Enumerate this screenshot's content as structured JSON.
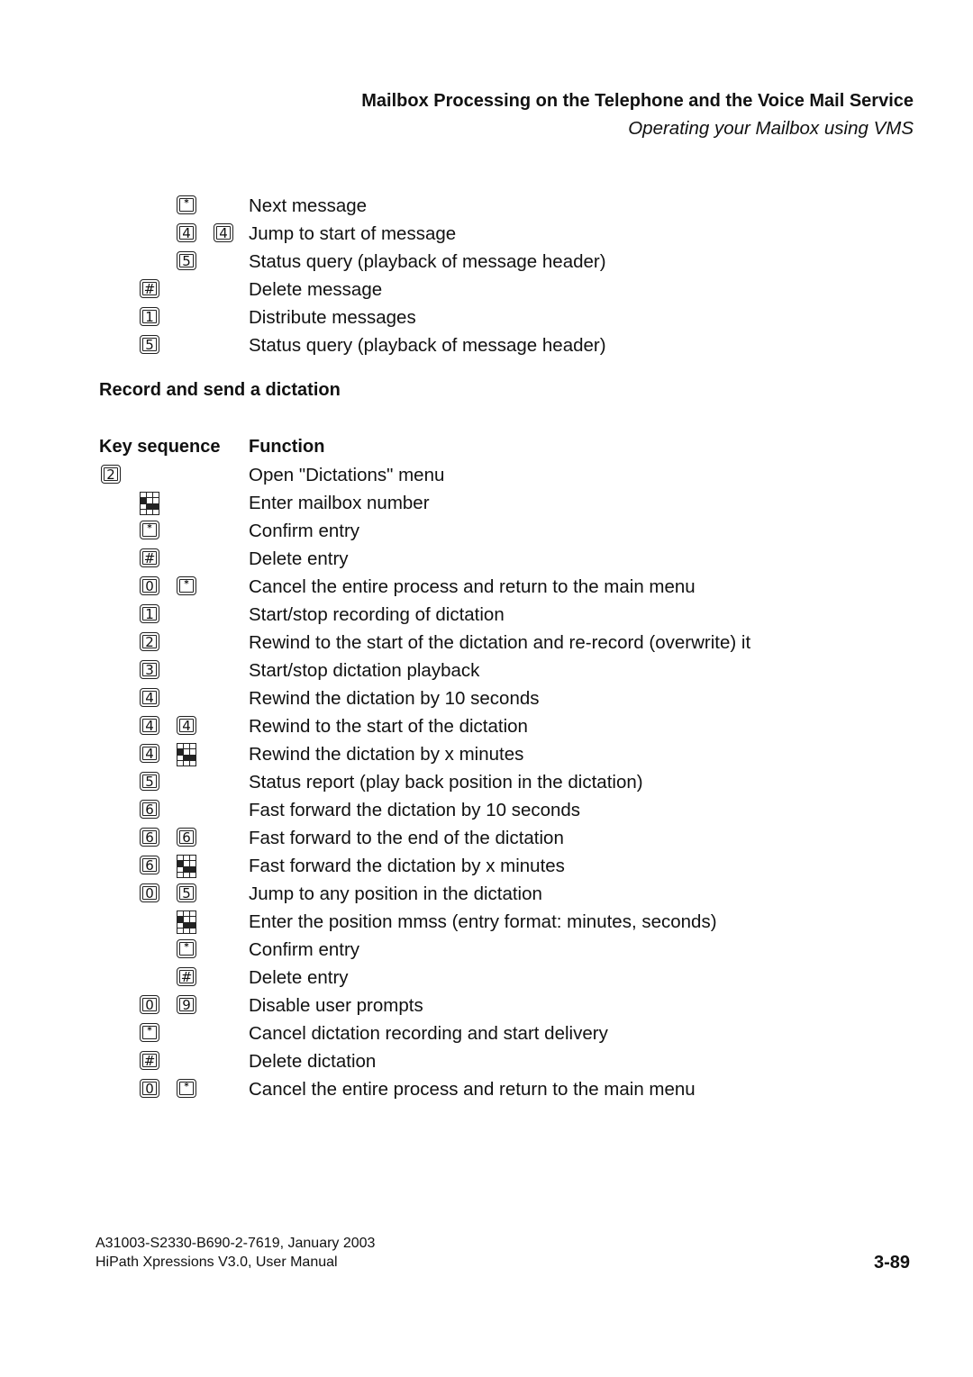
{
  "header": {
    "title": "Mailbox Processing on the Telephone and the Voice Mail Service",
    "subtitle": "Operating your Mailbox using VMS"
  },
  "top_rows": [
    {
      "keys": [
        {
          "level": 2,
          "key": "*"
        }
      ],
      "text": "Next message"
    },
    {
      "keys": [
        {
          "level": 2,
          "key": "4"
        },
        {
          "level": 3,
          "key": "4"
        }
      ],
      "text": "Jump to start of message"
    },
    {
      "keys": [
        {
          "level": 2,
          "key": "5"
        }
      ],
      "text": "Status query (playback of message header)"
    },
    {
      "keys": [
        {
          "level": 1,
          "key": "#"
        }
      ],
      "text": "Delete message"
    },
    {
      "keys": [
        {
          "level": 1,
          "key": "1"
        }
      ],
      "text": "Distribute messages"
    },
    {
      "keys": [
        {
          "level": 1,
          "key": "5"
        }
      ],
      "text": "Status query (playback of message header)"
    }
  ],
  "section": {
    "title": "Record and send a dictation",
    "col_key": "Key sequence",
    "col_function": "Function"
  },
  "rows": [
    {
      "keys": [
        {
          "level": 0,
          "key": "2"
        }
      ],
      "text": "Open \"Dictations\" menu"
    },
    {
      "keys": [
        {
          "level": 1,
          "key": "keypad"
        }
      ],
      "text": "Enter mailbox number"
    },
    {
      "keys": [
        {
          "level": 1,
          "key": "*"
        }
      ],
      "text": "Confirm entry"
    },
    {
      "keys": [
        {
          "level": 1,
          "key": "#"
        }
      ],
      "text": "Delete entry"
    },
    {
      "keys": [
        {
          "level": 1,
          "key": "0"
        },
        {
          "level": 2,
          "key": "*"
        }
      ],
      "text": "Cancel the entire process and return to the main menu"
    },
    {
      "keys": [
        {
          "level": 1,
          "key": "1"
        }
      ],
      "text": "Start/stop recording of dictation"
    },
    {
      "keys": [
        {
          "level": 1,
          "key": "2"
        }
      ],
      "text": "Rewind to the start of the dictation and re-record (overwrite) it"
    },
    {
      "keys": [
        {
          "level": 1,
          "key": "3"
        }
      ],
      "text": "Start/stop dictation playback"
    },
    {
      "keys": [
        {
          "level": 1,
          "key": "4"
        }
      ],
      "text": "Rewind the dictation by 10 seconds"
    },
    {
      "keys": [
        {
          "level": 1,
          "key": "4"
        },
        {
          "level": 2,
          "key": "4"
        }
      ],
      "text": "Rewind to the start of the dictation"
    },
    {
      "keys": [
        {
          "level": 1,
          "key": "4"
        },
        {
          "level": 2,
          "key": "keypad"
        }
      ],
      "text": "Rewind the dictation by x minutes"
    },
    {
      "keys": [
        {
          "level": 1,
          "key": "5"
        }
      ],
      "text": "Status report (play back position in the dictation)"
    },
    {
      "keys": [
        {
          "level": 1,
          "key": "6"
        }
      ],
      "text": "Fast forward the dictation by 10 seconds"
    },
    {
      "keys": [
        {
          "level": 1,
          "key": "6"
        },
        {
          "level": 2,
          "key": "6"
        }
      ],
      "text": "Fast forward to the end of the dictation"
    },
    {
      "keys": [
        {
          "level": 1,
          "key": "6"
        },
        {
          "level": 2,
          "key": "keypad"
        }
      ],
      "text": "Fast forward the dictation by x minutes"
    },
    {
      "keys": [
        {
          "level": 1,
          "key": "0"
        },
        {
          "level": 2,
          "key": "5"
        }
      ],
      "text": "Jump to any position in the dictation"
    },
    {
      "keys": [
        {
          "level": 2,
          "key": "keypad"
        }
      ],
      "text": "Enter the position mmss (entry format: minutes, seconds)"
    },
    {
      "keys": [
        {
          "level": 2,
          "key": "*"
        }
      ],
      "text": "Confirm entry"
    },
    {
      "keys": [
        {
          "level": 2,
          "key": "#"
        }
      ],
      "text": "Delete entry"
    },
    {
      "keys": [
        {
          "level": 1,
          "key": "0"
        },
        {
          "level": 2,
          "key": "9"
        }
      ],
      "text": "Disable user prompts"
    },
    {
      "keys": [
        {
          "level": 1,
          "key": "*"
        }
      ],
      "text": "Cancel dictation recording and start delivery"
    },
    {
      "keys": [
        {
          "level": 1,
          "key": "#"
        }
      ],
      "text": "Delete dictation"
    },
    {
      "keys": [
        {
          "level": 1,
          "key": "0"
        },
        {
          "level": 2,
          "key": "*"
        }
      ],
      "text": "Cancel the entire process and return to the main menu"
    }
  ],
  "footer": {
    "line1": "A31003-S2330-B690-2-7619, January 2003",
    "line2": "HiPath Xpressions V3.0, User Manual",
    "page": "3-89"
  }
}
